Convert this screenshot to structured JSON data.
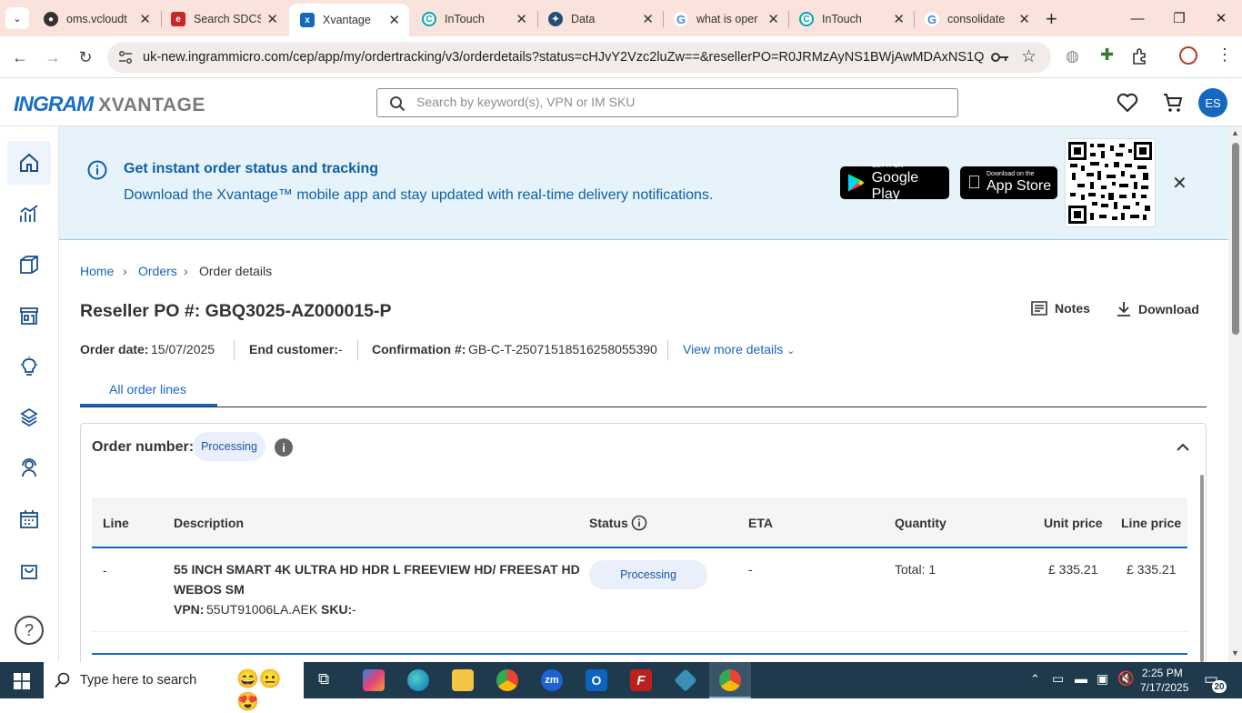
{
  "browser": {
    "tabs": [
      {
        "title": "oms.vcloudt",
        "favicon": "globe-icon",
        "color": "#333333"
      },
      {
        "title": "Search SDCS",
        "favicon": "ex-icon",
        "color": "#c62828"
      },
      {
        "title": "Xvantage",
        "favicon": "xvantage-icon",
        "color": "#1469bf",
        "active": true
      },
      {
        "title": "InTouch",
        "favicon": "intouch-icon",
        "color": "#00a6b6"
      },
      {
        "title": "Data",
        "favicon": "data-icon",
        "color": "#1f4e79"
      },
      {
        "title": "what is oper",
        "favicon": "google-icon",
        "color": "#4285f4"
      },
      {
        "title": "InTouch",
        "favicon": "intouch-icon",
        "color": "#00a6b6"
      },
      {
        "title": "consolidate",
        "favicon": "google-icon",
        "color": "#4285f4"
      }
    ],
    "new_tab": "+",
    "url": "uk-new.ingrammicro.com/cep/app/my/ordertracking/v3/orderdetails?status=cHJvY2Vzc2luZw==&resellerPO=R0JRMzAyNS1BWjAwMDAxNS1Q&o..."
  },
  "header": {
    "logo_brand": "INGRAM",
    "logo_product": "XVANTAGE",
    "search_placeholder": "Search by keyword(s), VPN or IM SKU",
    "avatar_initials": "ES"
  },
  "banner": {
    "title": "Get instant order status and tracking",
    "subtitle": "Download the Xvantage™ mobile app and stay updated with real-time delivery notifications.",
    "google_small": "GET IT ON",
    "google_big": "Google Play",
    "apple_small": "Download on the",
    "apple_big": "App Store"
  },
  "breadcrumb": {
    "home": "Home",
    "orders": "Orders",
    "current": "Order details"
  },
  "order": {
    "title": "Reseller PO #: GBQ3025-AZ000015-P",
    "notes_label": "Notes",
    "download_label": "Download",
    "order_date_label": "Order date:",
    "order_date": "15/07/2025",
    "end_customer_label": "End customer:",
    "end_customer": "-",
    "confirmation_label": "Confirmation #:",
    "confirmation": "GB-C-T-25071518516258055390",
    "view_more": "View more details",
    "tab_all_lines": "All order lines",
    "order_number_label": "Order number:",
    "order_status": "Processing"
  },
  "table": {
    "columns": [
      "Line",
      "Description",
      "Status",
      "ETA",
      "Quantity",
      "Unit price",
      "Line price"
    ],
    "rows": [
      {
        "line": "-",
        "description_1": "55 INCH SMART 4K ULTRA HD HDR L FREEVIEW HD/ FREESAT HD",
        "description_2": "WEBOS SM",
        "vpn_label": "VPN:",
        "vpn": "55UT91006LA.AEK",
        "sku_label": "SKU:",
        "sku": "-",
        "status": "Processing",
        "eta": "-",
        "quantity": "Total: 1",
        "unit_price": "£ 335.21",
        "line_price": "£ 335.21"
      }
    ]
  },
  "taskbar": {
    "search_placeholder": "Type here to search",
    "time": "2:25 PM",
    "date": "7/17/2025",
    "notification_count": "20"
  }
}
